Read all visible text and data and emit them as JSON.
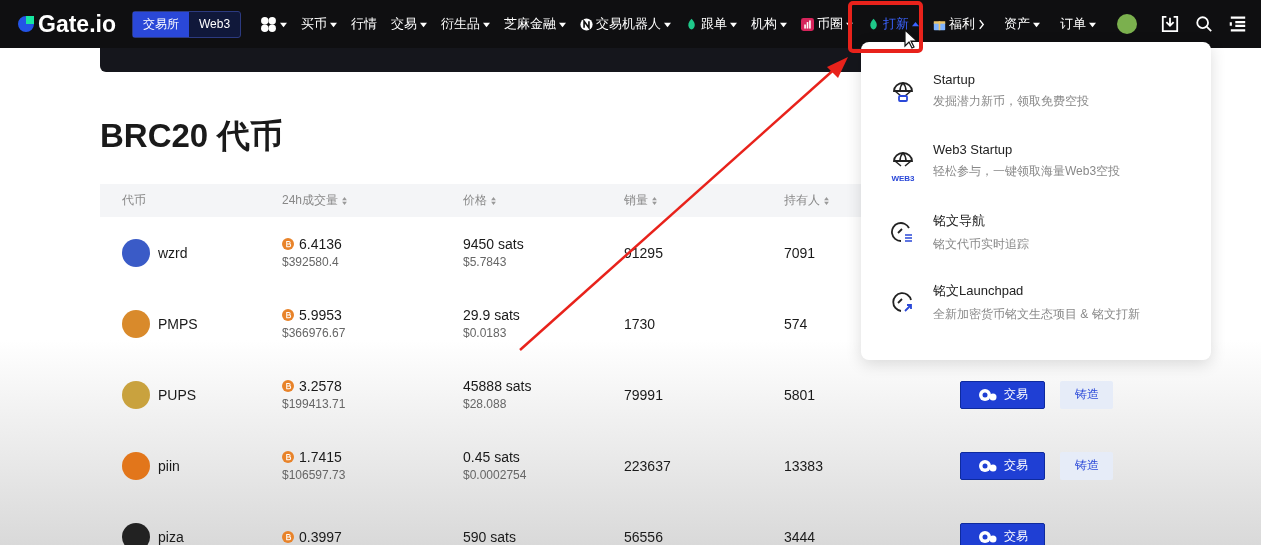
{
  "nav": {
    "logo": "Gate.io",
    "switch": [
      {
        "label": "交易所",
        "selected": true
      },
      {
        "label": "Web3",
        "selected": false
      }
    ],
    "items": [
      {
        "kind": "grid",
        "has_menu": true,
        "expanded": false,
        "selected": false
      },
      {
        "label": "买币",
        "kind": "text",
        "has_menu": true,
        "expanded": false,
        "selected": false
      },
      {
        "label": "行情",
        "kind": "text",
        "has_menu": false,
        "expanded": false,
        "selected": false
      },
      {
        "label": "交易",
        "kind": "text",
        "has_menu": true,
        "expanded": false,
        "selected": false
      },
      {
        "label": "衍生品",
        "kind": "text",
        "has_menu": true,
        "expanded": false,
        "selected": false
      },
      {
        "label": "芝麻金融",
        "kind": "text",
        "has_menu": true,
        "expanded": false,
        "selected": false
      },
      {
        "label": "交易机器人",
        "kind": "bot",
        "has_menu": true,
        "expanded": false,
        "selected": false
      },
      {
        "label": "跟单",
        "kind": "leaf",
        "has_menu": true,
        "expanded": false,
        "selected": false
      },
      {
        "label": "机构",
        "kind": "text",
        "has_menu": true,
        "expanded": false,
        "selected": false
      },
      {
        "label": "币圈",
        "kind": "chart",
        "has_menu": true,
        "expanded": false,
        "selected": false
      },
      {
        "label": "打新",
        "kind": "leaf",
        "has_menu": true,
        "expanded": true,
        "selected": true
      },
      {
        "label": "福利",
        "kind": "gift-link",
        "has_menu": false,
        "expanded": false,
        "selected": false
      }
    ],
    "right_items": [
      {
        "label": "资产"
      },
      {
        "label": "订单"
      }
    ]
  },
  "title": "BRC20 代币",
  "table": {
    "columns": [
      {
        "label": "代币",
        "sortable": false
      },
      {
        "label": "24h成交量",
        "sortable": true
      },
      {
        "label": "价格",
        "sortable": true
      },
      {
        "label": "销量",
        "sortable": true
      },
      {
        "label": "持有人",
        "sortable": true
      }
    ],
    "rows": [
      {
        "name": "wzrd",
        "volume_btc": "6.4136",
        "volume_usd": "$392580.4",
        "price_sats": "9450 sats",
        "price_usd": "$5.7843",
        "sales": "91295",
        "holders": "7091"
      },
      {
        "name": "PMPS",
        "volume_btc": "5.9953",
        "volume_usd": "$366976.67",
        "price_sats": "29.9 sats",
        "price_usd": "$0.0183",
        "sales": "1730",
        "holders": "574"
      },
      {
        "name": "PUPS",
        "volume_btc": "3.2578",
        "volume_usd": "$199413.71",
        "price_sats": "45888 sats",
        "price_usd": "$28.088",
        "sales": "79991",
        "holders": "5801",
        "actions": [
          {
            "label": "交易",
            "kind": "trade"
          },
          {
            "label": "铸造",
            "kind": "mint"
          }
        ]
      },
      {
        "name": "piin",
        "volume_btc": "1.7415",
        "volume_usd": "$106597.73",
        "price_sats": "0.45 sats",
        "price_usd": "$0.0002754",
        "sales": "223637",
        "holders": "13383",
        "actions": [
          {
            "label": "交易",
            "kind": "trade"
          },
          {
            "label": "铸造",
            "kind": "mint"
          }
        ]
      },
      {
        "name": "piza",
        "volume_btc": "0.3997",
        "price_sats": "590 sats",
        "sales": "56556",
        "holders": "3444",
        "actions": [
          {
            "label": "交易",
            "kind": "trade"
          }
        ]
      }
    ]
  },
  "dropdown": {
    "items": [
      {
        "title": "Startup",
        "subtitle": "发掘潜力新币，领取免费空投",
        "kind": "parachute"
      },
      {
        "title": "Web3 Startup",
        "subtitle": "轻松参与，一键领取海量Web3空投",
        "kind": "parachute",
        "badge": "WEB3"
      },
      {
        "title": "铭文导航",
        "subtitle": "铭文代币实时追踪",
        "kind": "gauge-list"
      },
      {
        "title": "铭文Launchpad",
        "subtitle": "全新加密货币铭文生态项目 & 铭文打新",
        "kind": "gauge-arrow"
      }
    ]
  }
}
